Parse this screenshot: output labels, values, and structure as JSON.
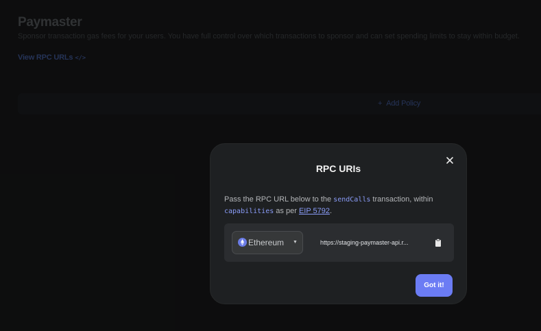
{
  "page": {
    "title": "Paymaster",
    "description": "Sponsor transaction gas fees for your users. You have full control over which transactions to sponsor and can set spending limits to stay within budget.",
    "rpc_link_label": "View RPC URLs",
    "rpc_link_code": "</>",
    "add_policy_plus": "+",
    "add_policy_label": "Add Policy"
  },
  "modal": {
    "title": "RPC URIs",
    "desc_part1": "Pass the RPC URL below to the ",
    "desc_code1": "sendCalls",
    "desc_part2": " transaction, within ",
    "desc_code2": "capabilities",
    "desc_part3": " as per ",
    "desc_link": "EIP 5792",
    "desc_part4": ".",
    "chain": {
      "selected": "Ethereum",
      "icon": "ethereum-icon"
    },
    "url": "https://staging-paymaster-api.r...",
    "confirm_label": "Got it!"
  },
  "colors": {
    "accent": "#6b7cf4",
    "link": "#8a9cf8",
    "modal_bg": "#1e2022",
    "panel_bg": "#2b2d30"
  }
}
